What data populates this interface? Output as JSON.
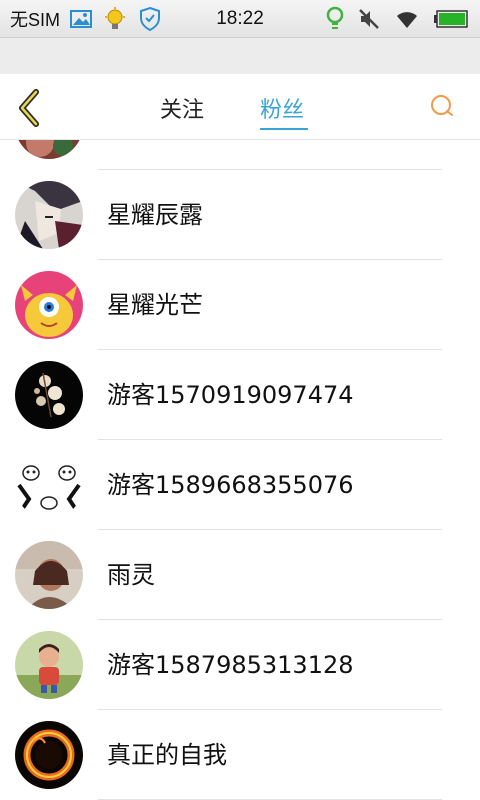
{
  "status_bar": {
    "carrier": "无SIM",
    "time": "18:22"
  },
  "header": {
    "tabs": [
      {
        "label": "关注",
        "active": false
      },
      {
        "label": "粉丝",
        "active": true
      }
    ],
    "accent_color": "#3aa4d8"
  },
  "fans": [
    {
      "name": "星耀辰露",
      "avatar": "anime-avatar"
    },
    {
      "name": "星耀光芒",
      "avatar": "monster-avatar"
    },
    {
      "name": "游客1570919097474",
      "avatar": "flower-avatar"
    },
    {
      "name": "游客1589668355076",
      "avatar": "meme-avatar"
    },
    {
      "name": "雨灵",
      "avatar": "portrait-avatar"
    },
    {
      "name": "游客1587985313128",
      "avatar": "child-avatar"
    },
    {
      "name": "真正的自我",
      "avatar": "fire-ring-avatar"
    }
  ]
}
